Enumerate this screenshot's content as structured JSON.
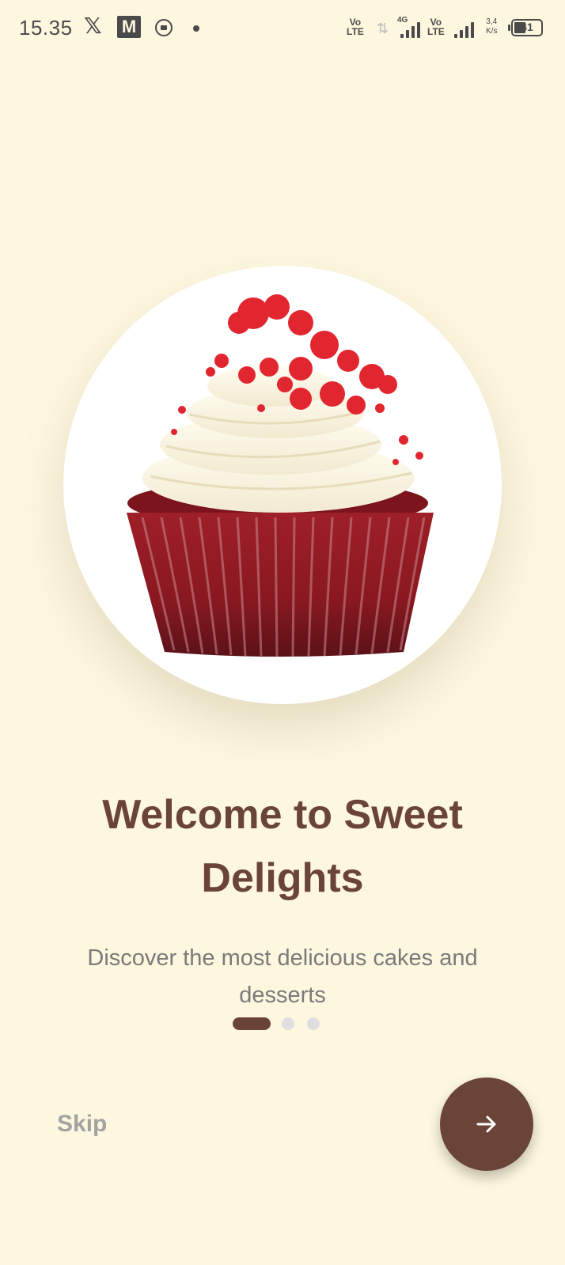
{
  "status_bar": {
    "time": "15.35",
    "network_label_1": "Vo LTE",
    "network_label_2": "Vo LTE",
    "network_type": "4G",
    "speed": "3,4 K/s",
    "battery": "41",
    "icons": [
      "x-logo-icon",
      "m-logo-icon",
      "message-icon",
      "notification-dot-icon",
      "data-arrows-icon",
      "signal-bars-icon",
      "signal-bars-icon",
      "battery-icon"
    ]
  },
  "onboarding": {
    "image": "red-velvet-cupcake",
    "title": "Welcome to Sweet Delights",
    "subtitle": "Discover the most delicious cakes and desserts",
    "page_index": 1,
    "page_count": 3
  },
  "actions": {
    "skip_label": "Skip",
    "next_icon": "arrow-right-icon"
  },
  "colors": {
    "background": "#FDF7DF",
    "primary": "#6B4438",
    "indicator_inactive": "#DEDEDE",
    "subtitle": "#7A7A7A",
    "skip": "#A3A3A3"
  }
}
